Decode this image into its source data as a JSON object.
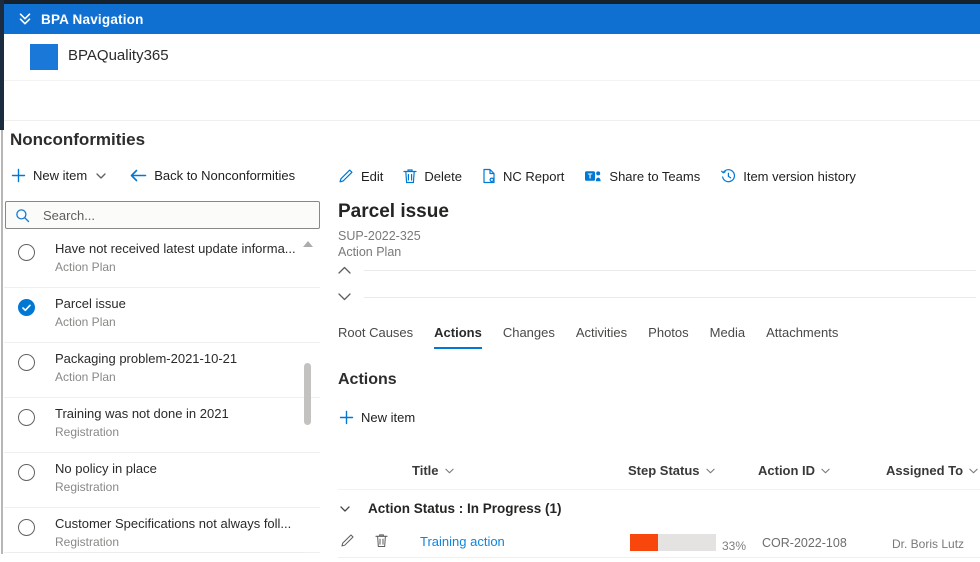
{
  "colors": {
    "accent": "#0078d4",
    "nav_blue": "#1070d2",
    "progress_orange": "#f8470d"
  },
  "nav_bar": {
    "title": "BPA Navigation"
  },
  "site_header": {
    "title": "BPAQuality365"
  },
  "page_title": "Nonconformities",
  "left_panel": {
    "new_item_label": "New item",
    "back_label": "Back to Nonconformities",
    "search_placeholder": "Search...",
    "items": [
      {
        "title": "Have not received latest update informa...",
        "subtitle": "Action Plan",
        "selected": false
      },
      {
        "title": "Parcel issue",
        "subtitle": "Action Plan",
        "selected": true
      },
      {
        "title": "Packaging problem-2021-10-21",
        "subtitle": "Action Plan",
        "selected": false
      },
      {
        "title": "Training was not done in 2021",
        "subtitle": "Registration",
        "selected": false
      },
      {
        "title": "No policy in place",
        "subtitle": "Registration",
        "selected": false
      },
      {
        "title": "Customer Specifications not always foll...",
        "subtitle": "Registration",
        "selected": false
      }
    ]
  },
  "toolbar": {
    "edit": "Edit",
    "delete": "Delete",
    "nc_report": "NC Report",
    "share": "Share to Teams",
    "history": "Item version history"
  },
  "detail": {
    "title": "Parcel issue",
    "ref_id": "SUP-2022-325",
    "category": "Action Plan",
    "tabs": [
      {
        "label": "Root Causes",
        "active": false
      },
      {
        "label": "Actions",
        "active": true
      },
      {
        "label": "Changes",
        "active": false
      },
      {
        "label": "Activities",
        "active": false
      },
      {
        "label": "Photos",
        "active": false
      },
      {
        "label": "Media",
        "active": false
      },
      {
        "label": "Attachments",
        "active": false
      }
    ],
    "section_title": "Actions",
    "new_item_label": "New item",
    "table": {
      "columns": [
        "Title",
        "Step Status",
        "Action ID",
        "Assigned To"
      ],
      "group_label": "Action Status : In Progress (1)",
      "rows": [
        {
          "title": "Training action",
          "progress_pct": 33,
          "progress_label": "33%",
          "action_id": "COR-2022-108",
          "assigned_to": "Dr. Boris Lutz"
        }
      ]
    }
  }
}
